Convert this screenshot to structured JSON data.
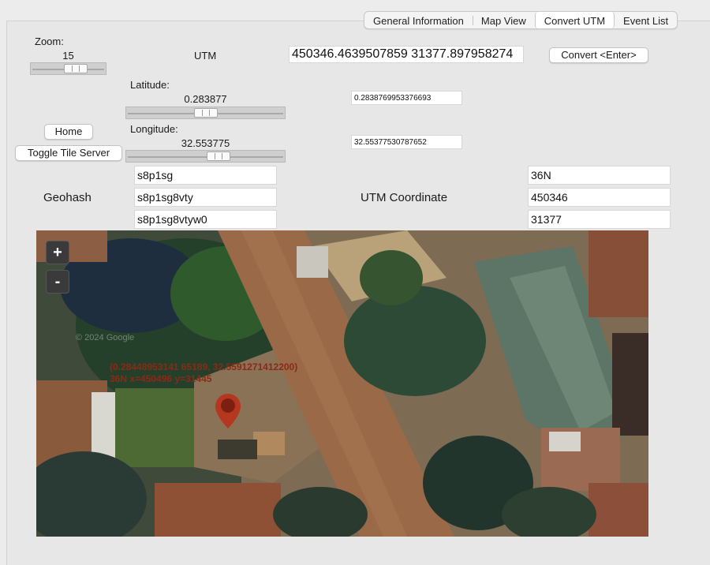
{
  "tabs": [
    {
      "label": "General Information",
      "active": false
    },
    {
      "label": "Map View",
      "active": false
    },
    {
      "label": "Convert UTM",
      "active": true
    },
    {
      "label": "Event List",
      "active": false
    }
  ],
  "zoom": {
    "label": "Zoom:",
    "value": "15",
    "slider_fraction": 0.6
  },
  "utm": {
    "label": "UTM",
    "value": "450346.4639507859 31377.897958274",
    "convert_button": "Convert <Enter>"
  },
  "latitude": {
    "label": "Latitude:",
    "display": "0.283877",
    "value": "0.2838769953376693",
    "slider_fraction": 0.5
  },
  "longitude": {
    "label": "Longitude:",
    "display": "32.553775",
    "value": "32.55377530787652",
    "slider_fraction": 0.59
  },
  "buttons": {
    "home": "Home",
    "toggle_tile_server": "Toggle Tile Server"
  },
  "geohash": {
    "label": "Geohash",
    "values": [
      "s8p1sg",
      "s8p1sg8vty",
      "s8p1sg8vtyw0"
    ]
  },
  "utm_coordinate": {
    "label": "UTM Coordinate",
    "values": [
      "36N",
      "450346",
      "31377"
    ]
  },
  "map": {
    "zoom_in": "+",
    "zoom_out": "-",
    "marker_line1": "(0.28448953141 65189, 32.5591271412200)",
    "marker_line2": "36N x=450496 y=31445",
    "watermark": "© 2024 Google",
    "marker_icon": "map-pin-icon",
    "marker_color": "#b5371f"
  }
}
